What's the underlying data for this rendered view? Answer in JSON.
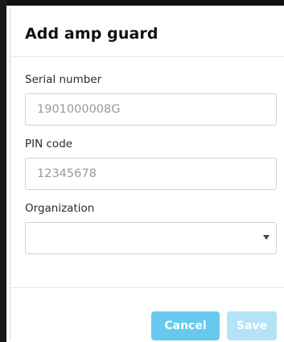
{
  "dialog": {
    "title": "Add amp guard",
    "fields": {
      "serial": {
        "label": "Serial number",
        "placeholder": "1901000008G"
      },
      "pin": {
        "label": "PIN code",
        "placeholder": "12345678"
      },
      "organization": {
        "label": "Organization",
        "selected": ""
      }
    },
    "buttons": {
      "cancel": "Cancel",
      "save": "Save"
    }
  },
  "colors": {
    "primary_button": "#66c9ee",
    "disabled_button": "#b3e3f6",
    "title_text": "#111111",
    "placeholder_text": "#9a9a9a"
  },
  "icons": {
    "select_caret": "chevron-down-icon"
  }
}
